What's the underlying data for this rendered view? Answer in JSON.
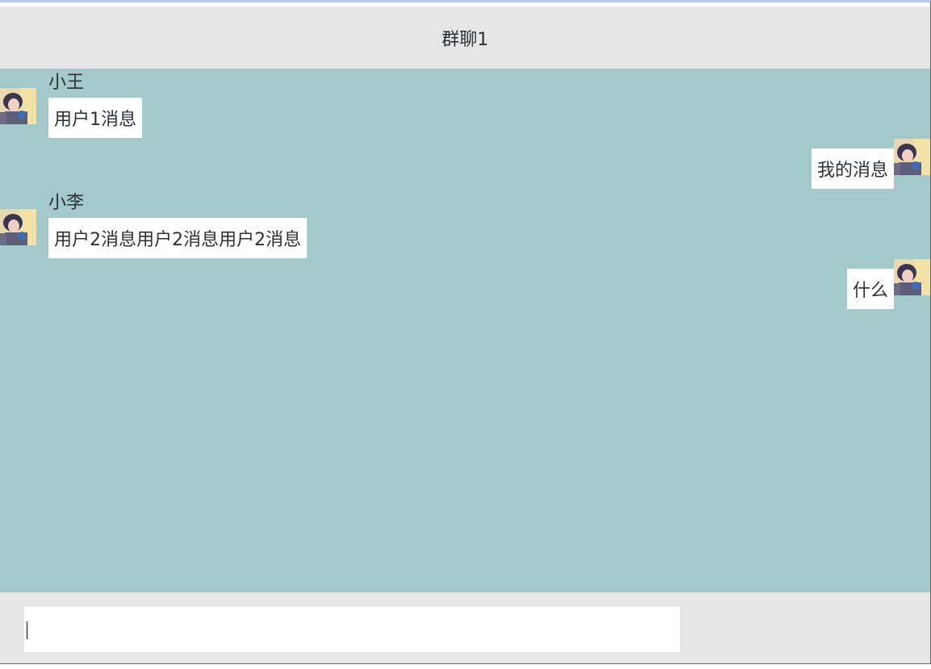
{
  "header": {
    "title": "群聊1"
  },
  "messages": [
    {
      "side": "left",
      "sender": "小王",
      "text": "用户1消息",
      "avatar": "user-avatar"
    },
    {
      "side": "right",
      "sender": "",
      "text": "我的消息",
      "avatar": "user-avatar"
    },
    {
      "side": "left",
      "sender": "小李",
      "text": "用户2消息用户2消息用户2消息",
      "avatar": "user-avatar"
    },
    {
      "side": "right",
      "sender": "",
      "text": "什么",
      "avatar": "user-avatar"
    }
  ],
  "composer": {
    "value": "",
    "placeholder": ""
  },
  "colors": {
    "header_bg": "#e6e6e6",
    "chat_bg": "#a4c9ca",
    "bubble_bg": "#ffffff",
    "text": "#2b3138"
  }
}
